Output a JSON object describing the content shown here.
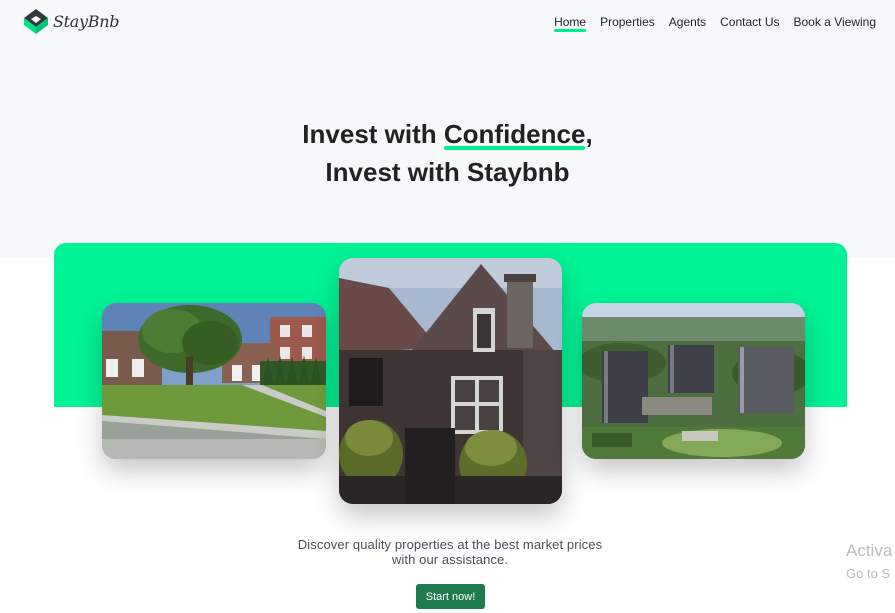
{
  "brand": {
    "name": "StayBnb",
    "accent": "#00ee90",
    "band_color": "#00f394",
    "button_color": "#1e7a4f"
  },
  "nav": {
    "items": [
      {
        "label": "Home",
        "active": true
      },
      {
        "label": "Properties"
      },
      {
        "label": "Agents"
      },
      {
        "label": "Contact Us"
      },
      {
        "label": "Book a Viewing"
      }
    ]
  },
  "hero": {
    "line1_prefix": "Invest with ",
    "line1_highlight": "Confidence",
    "line1_suffix": ",",
    "line2_prefix": "Invest with ",
    "line2_bold": "Staybnb"
  },
  "gallery": {
    "images": [
      {
        "icon": "suburban-house-photo"
      },
      {
        "icon": "brick-house-photo"
      },
      {
        "icon": "tower-complex-photo"
      }
    ]
  },
  "tagline": {
    "line1": "Discover quality properties at the best market prices",
    "line2": "with our assistance."
  },
  "cta": {
    "label": "Start now!"
  },
  "watermark": {
    "line1": "Activa",
    "line2": "Go to S"
  }
}
